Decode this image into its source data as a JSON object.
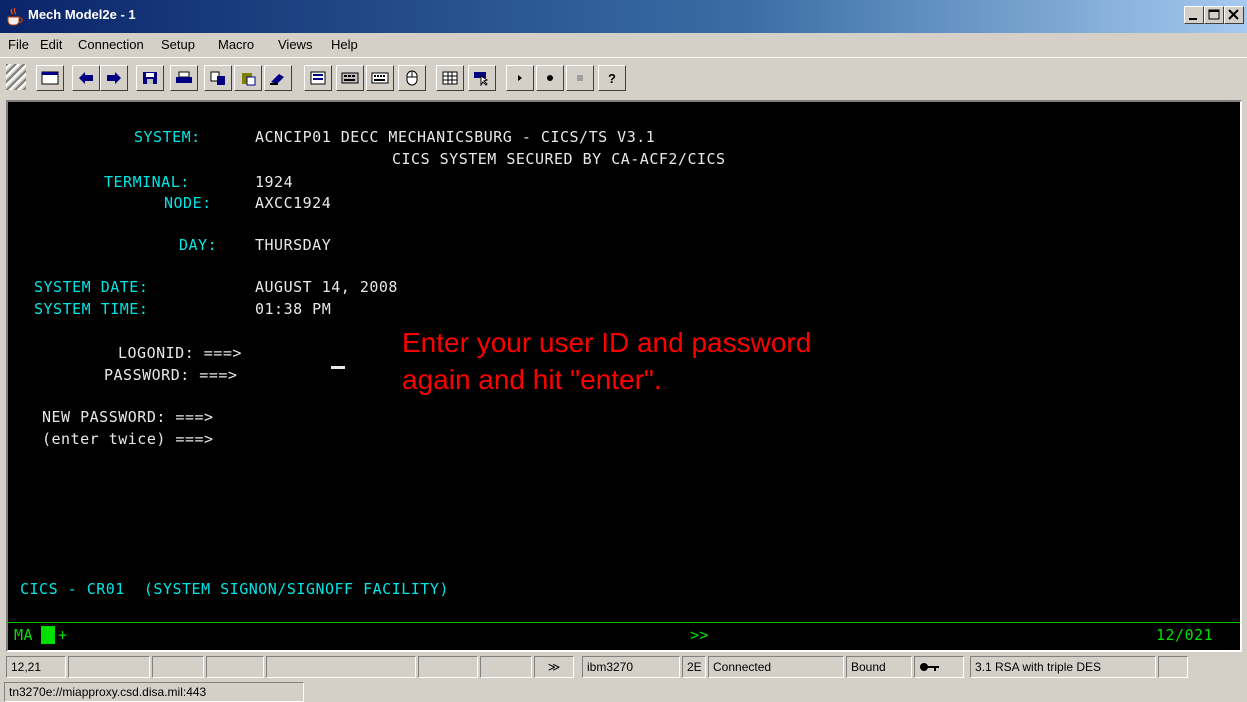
{
  "window": {
    "title": "Mech Model2e - 1",
    "controls": [
      "_",
      "□",
      "×"
    ]
  },
  "menu": [
    "File",
    "Edit",
    "Connection",
    "Setup",
    "Macro",
    "Views",
    "Help"
  ],
  "toolbar": {
    "buttons": [
      "display-icon",
      "back-arrow-icon",
      "forward-arrow-icon",
      "save-icon",
      "print-icon",
      "copy-icon",
      "paste-icon",
      "clear-icon",
      "printer-icon",
      "keypad-icon",
      "macro-keypad-icon",
      "mouse-icon",
      "grid-icon",
      "pointer-icon",
      "play-icon",
      "record-icon",
      "stop-icon",
      "help-icon"
    ]
  },
  "terminal": {
    "system_label": "SYSTEM:",
    "system_value": "ACNCIP01 DECC MECHANICSBURG - CICS/TS V3.1",
    "secured_line": "CICS SYSTEM SECURED BY CA-ACF2/CICS",
    "terminal_label": "TERMINAL:",
    "terminal_value": "1924",
    "node_label": "NODE:",
    "node_value": "AXCC1924",
    "day_label": "DAY:",
    "day_value": "THURSDAY",
    "date_label": "SYSTEM DATE:",
    "date_value": "AUGUST 14, 2008",
    "time_label": "SYSTEM TIME:",
    "time_value": "01:38 PM",
    "logonid_label": "LOGONID: ===>",
    "password_label": "PASSWORD: ===>",
    "new_password_label": "NEW PASSWORD: ===>",
    "enter_twice_label": "(enter twice) ===>",
    "note_line1": "Enter your user ID and password",
    "note_line2": "again and hit \"enter\".",
    "footer": "CICS - CR01  (SYSTEM SIGNON/SIGNOFF FACILITY)",
    "oia_left": "MA",
    "oia_plus": "+",
    "oia_mid": ">>",
    "oia_right": "12/021"
  },
  "status": {
    "cursor_pos": "12,21",
    "arrows": "≫",
    "terminal_type": "ibm3270",
    "model": "2E",
    "connection": "Connected",
    "bound": "Bound",
    "encryption": "3.1 RSA with triple DES",
    "url": "tn3270e://miapproxy.csd.disa.mil:443"
  }
}
